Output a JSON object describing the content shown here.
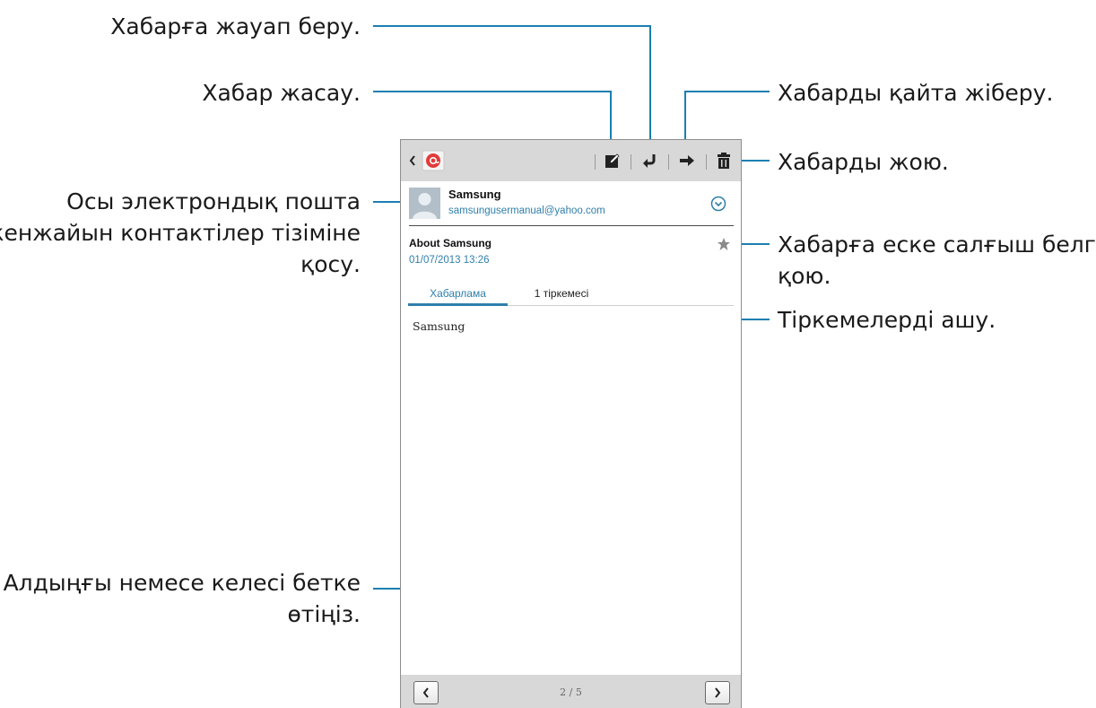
{
  "callouts": {
    "reply": "Хабарға жауап беру.",
    "compose": "Хабар жасау.",
    "forward": "Хабарды қайта жіберу.",
    "delete": "Хабарды жою.",
    "add_contact_line1": "Осы электрондық пошта",
    "add_contact_line2": "мекенжайын контактілер тізіміне",
    "add_contact_line3": "қосу.",
    "reminder_line1": "Хабарға еске салғыш белгісін",
    "reminder_line2": "қою.",
    "attachments": "Тіркемелерді ашу.",
    "navigate_line1": "Алдыңғы немесе келесі бетке",
    "navigate_line2": "өтіңіз."
  },
  "email": {
    "sender_name": "Samsung",
    "sender_email": "samsungusermanual@yahoo.com",
    "subject": "About Samsung",
    "datetime": "01/07/2013 13:26",
    "tabs": {
      "message": "Хабарлама",
      "attachments": "1 тіркемесі"
    },
    "body": "Samsung"
  },
  "pagination": {
    "indicator": "2 / 5"
  },
  "icons": {
    "back": "chevron-left-icon",
    "app": "email-app-icon",
    "compose": "compose-icon",
    "reply": "reply-icon",
    "forward": "forward-icon",
    "delete": "trash-icon",
    "expand": "expand-circle-icon",
    "star": "star-icon",
    "prev": "chevron-left-icon",
    "next": "chevron-right-icon"
  },
  "colors": {
    "accent": "#1b7fb1",
    "link": "#2f7fab",
    "bar": "#d8d8d8",
    "app_icon_red": "#e23b3b"
  }
}
